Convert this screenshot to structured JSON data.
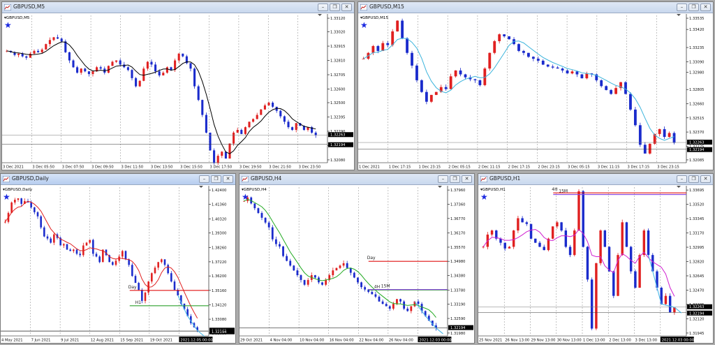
{
  "windows": [
    {
      "id": "m5",
      "title": "GBPUSD,M5",
      "label": "GBPUSD,M5",
      "star": true,
      "prices": [
        "1.33120",
        "1.33020",
        "1.32915",
        "1.32810",
        "1.32705",
        "1.32600",
        "1.32500",
        "1.32395",
        "1.32290",
        "1.32185",
        "1.32080"
      ],
      "bid_tag": "1.32263",
      "ask_tag": "1.32194",
      "times": [
        "3 Dec 2021",
        "3 Dec 05:50",
        "3 Dec 07:50",
        "3 Dec 09:50",
        "3 Dec 11:50",
        "3 Dec 13:50",
        "3 Dec 15:50",
        "3 Dec 17:50",
        "3 Dec 19:50",
        "3 Dec 21:50",
        "3 Dec 23:50"
      ],
      "ma_color": "#000000",
      "close_path": [
        1.3288,
        1.3287,
        1.3285,
        1.3286,
        1.3284,
        1.3283,
        1.3286,
        1.3288,
        1.3287,
        1.3289,
        1.3293,
        1.3296,
        1.3298,
        1.3297,
        1.3295,
        1.3287,
        1.3281,
        1.3276,
        1.3272,
        1.3275,
        1.3273,
        1.3271,
        1.3273,
        1.3276,
        1.3275,
        1.3272,
        1.3277,
        1.328,
        1.3281,
        1.3278,
        1.3276,
        1.3274,
        1.3268,
        1.3262,
        1.3266,
        1.3275,
        1.328,
        1.3278,
        1.3273,
        1.327,
        1.3272,
        1.3276,
        1.3274,
        1.3281,
        1.3286,
        1.3284,
        1.3279,
        1.3275,
        1.3262,
        1.3252,
        1.3241,
        1.3228,
        1.3215,
        1.3206,
        1.3211,
        1.3214,
        1.3209,
        1.322,
        1.3228,
        1.323,
        1.3227,
        1.3232,
        1.3236,
        1.3238,
        1.3241,
        1.3245,
        1.3248,
        1.325,
        1.3247,
        1.3244,
        1.324,
        1.3236,
        1.3232,
        1.323,
        1.3235,
        1.3233,
        1.323,
        1.3232,
        1.3228,
        1.3226
      ]
    },
    {
      "id": "m15",
      "title": "GBPUSD,M15",
      "label": "GBPUSD,M15",
      "star": true,
      "prices": [
        "1.33535",
        "1.33420",
        "1.33235",
        "1.33090",
        "1.32980",
        "1.32805",
        "1.32660",
        "1.32515",
        "1.32370",
        "1.32225",
        "1.32085"
      ],
      "bid_tag": "1.32263",
      "ask_tag": "1.32194",
      "times": [
        "1 Dec 2021",
        "1 Dec 17:15",
        "1 Dec 23:15",
        "2 Dec 05:15",
        "2 Dec 11:15",
        "2 Dec 17:15",
        "2 Dec 23:15",
        "3 Dec 05:15",
        "3 Dec 11:15",
        "3 Dec 17:15",
        "3 Dec 23:15"
      ],
      "ma_color": "#3cb4dc",
      "close_path": [
        1.3312,
        1.3318,
        1.3325,
        1.332,
        1.3328,
        1.3326,
        1.334,
        1.3351,
        1.3333,
        1.3318,
        1.3305,
        1.329,
        1.3278,
        1.3268,
        1.3275,
        1.3278,
        1.3283,
        1.3281,
        1.3294,
        1.33,
        1.3296,
        1.3293,
        1.3291,
        1.329,
        1.3285,
        1.3302,
        1.3318,
        1.333,
        1.3337,
        1.3335,
        1.3332,
        1.3327,
        1.332,
        1.3318,
        1.3314,
        1.3312,
        1.331,
        1.3306,
        1.3304,
        1.3303,
        1.3302,
        1.33,
        1.3297,
        1.3299,
        1.3296,
        1.3292,
        1.3297,
        1.3296,
        1.329,
        1.3284,
        1.328,
        1.3276,
        1.3282,
        1.3288,
        1.3276,
        1.326,
        1.3244,
        1.3224,
        1.3215,
        1.3225,
        1.3235,
        1.324,
        1.3232,
        1.3236,
        1.3226
      ]
    },
    {
      "id": "daily",
      "title": "GBPUSD,Daily",
      "label": "GBPUSD,Daily",
      "star": true,
      "prices": [
        "1.42400",
        "1.41360",
        "1.40320",
        "1.39300",
        "1.38260",
        "1.37220",
        "1.36200",
        "1.35160",
        "1.34120",
        "1.33080",
        "1.32080"
      ],
      "bid_tag": "1.32263",
      "ask_tag": "1.32194",
      "times": [
        "4 May 2021",
        "7 Jun 2021",
        "9 Jul 2021",
        "12 Aug 2021",
        "15 Sep 2021",
        "19 Oct 2021",
        "2021.12.05 00:00"
      ],
      "levels": [
        {
          "label": "Day",
          "price": 1.3516,
          "color": "#e01010"
        },
        {
          "label": "H1",
          "price": 1.3405,
          "color": "#2ea02e"
        }
      ],
      "ma_color": "#e02020",
      "close_path": [
        1.401,
        1.4075,
        1.415,
        1.417,
        1.418,
        1.414,
        1.416,
        1.415,
        1.4115,
        1.408,
        1.405,
        1.397,
        1.3905,
        1.389,
        1.386,
        1.392,
        1.3895,
        1.384,
        1.385,
        1.381,
        1.38,
        1.381,
        1.378,
        1.377,
        1.384,
        1.386,
        1.388,
        1.378,
        1.376,
        1.372,
        1.381,
        1.377,
        1.372,
        1.37,
        1.373,
        1.376,
        1.38,
        1.374,
        1.37,
        1.362,
        1.357,
        1.352,
        1.344,
        1.35,
        1.358,
        1.364,
        1.368,
        1.372,
        1.374,
        1.37,
        1.364,
        1.358,
        1.352,
        1.348,
        1.342,
        1.338,
        1.333,
        1.328,
        1.325,
        1.3226
      ]
    },
    {
      "id": "h4",
      "title": "GBPUSD,H4",
      "label": "GBPUSD,H4",
      "star": true,
      "prices": [
        "1.37960",
        "1.37360",
        "1.36770",
        "1.36170",
        "1.35570",
        "1.34980",
        "1.34380",
        "1.33780",
        "1.33190",
        "1.32590",
        "1.31980"
      ],
      "bid_tag": "1.32194",
      "ask_tag": "1.32194",
      "times": [
        "29 Oct 2021",
        "4 Nov 04:00",
        "10 Nov 04:00",
        "16 Nov 04:00",
        "22 Nov 04:00",
        "26 Nov 04:00",
        "2021.12.03 00:00"
      ],
      "levels": [
        {
          "label": "Day",
          "price": 1.3498,
          "color": "#e01010"
        },
        {
          "label": "4H",
          "price": 1.3378,
          "color": "#2ea02e"
        },
        {
          "label": "15M",
          "price": 1.338,
          "color": "#8844dd"
        }
      ],
      "ma_color": "#22aa22",
      "close_path": [
        1.375,
        1.3765,
        1.374,
        1.372,
        1.37,
        1.368,
        1.366,
        1.364,
        1.359,
        1.357,
        1.356,
        1.352,
        1.35,
        1.348,
        1.346,
        1.344,
        1.342,
        1.34,
        1.342,
        1.344,
        1.343,
        1.341,
        1.34,
        1.342,
        1.344,
        1.346,
        1.347,
        1.348,
        1.349,
        1.347,
        1.345,
        1.343,
        1.341,
        1.339,
        1.338,
        1.337,
        1.336,
        1.335,
        1.333,
        1.332,
        1.331,
        1.33,
        1.332,
        1.334,
        1.333,
        1.33,
        1.329,
        1.331,
        1.333,
        1.332,
        1.329,
        1.327,
        1.325,
        1.323,
        1.3219
      ]
    },
    {
      "id": "h1",
      "title": "GBPUSD,H1",
      "label": "GBPUSD,H1",
      "star": true,
      "prices": [
        "1.33695",
        "1.33520",
        "1.33345",
        "1.33170",
        "1.32995",
        "1.32820",
        "1.32645",
        "1.32470",
        "1.32295",
        "1.32120",
        "1.31945"
      ],
      "bid_tag": "1.32263",
      "ask_tag": "1.32194",
      "times": [
        "25 Nov 2021",
        "26 Nov 13:00",
        "29 Nov 13:00",
        "30 Nov 13:00",
        "1 Dec 13:00",
        "2 Dec 13:00",
        "3 Dec 13:00",
        "2021.12.03 00:00"
      ],
      "levels": [
        {
          "label": "4H",
          "price": 1.3366,
          "color": "#e01010"
        },
        {
          "label": "15M",
          "price": 1.3364,
          "color": "#8844dd"
        }
      ],
      "ma_color": "#d020d0",
      "close_path": [
        1.33,
        1.3315,
        1.332,
        1.331,
        1.3305,
        1.3298,
        1.33,
        1.332,
        1.3335,
        1.333,
        1.3328,
        1.331,
        1.3305,
        1.33,
        1.3296,
        1.331,
        1.3325,
        1.333,
        1.332,
        1.33,
        1.329,
        1.332,
        1.3368,
        1.33,
        1.326,
        1.32,
        1.328,
        1.332,
        1.33,
        1.327,
        1.324,
        1.329,
        1.333,
        1.33,
        1.327,
        1.325,
        1.329,
        1.332,
        1.329,
        1.327,
        1.325,
        1.323,
        1.324,
        1.322,
        1.3226
      ]
    }
  ]
}
